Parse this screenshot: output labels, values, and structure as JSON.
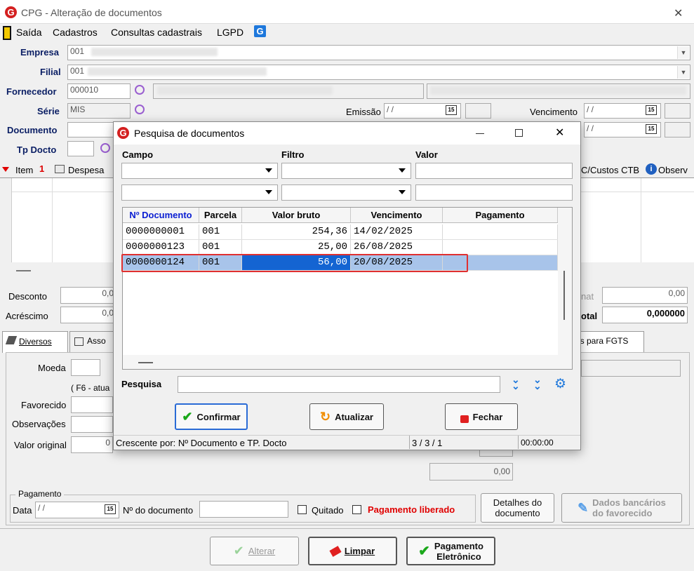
{
  "window": {
    "title": "CPG - Alteração de documentos",
    "close": "✕"
  },
  "menu": {
    "exit": "Saída",
    "cadastros": "Cadastros",
    "consultas": "Consultas cadastrais",
    "lgpd": "LGPD"
  },
  "form": {
    "empresa_label": "Empresa",
    "empresa_value": "001",
    "filial_label": "Filial",
    "filial_value": "001",
    "fornecedor_label": "Fornecedor",
    "fornecedor_value": "000010",
    "serie_label": "Série",
    "serie_value": "MIS",
    "emissao_label": "Emissão",
    "emissao_value": " / / ",
    "vencimento_label": "Vencimento",
    "vencimento_value": " / / ",
    "documento_label": "Documento",
    "tpdocto_label": "Tp Docto",
    "date2_value": " / / "
  },
  "grid": {
    "item_col": "Item",
    "despesa_col": "Despesa",
    "ccustos_col": "C/Custos CTB",
    "observ_col": "Observ"
  },
  "totals": {
    "desconto_label": "Desconto",
    "desconto_value": "0,0",
    "acrescimo_label": "Acréscimo",
    "acrescimo_value": "0,0",
    "nat_label": "nat",
    "nat_value": "0,00",
    "total_label": "otal",
    "total_value": "0,000000"
  },
  "tabs": {
    "diversos": "Diversos",
    "asso": "Asso",
    "fgts": "os para FGTS"
  },
  "lower": {
    "moeda_label": "Moeda",
    "f6_hint": "( F6 - atua",
    "favorecido_label": "Favorecido",
    "observacoes_label": "Observações",
    "valor_original_label": "Valor original",
    "valor_original_value": "0",
    "amount_value": "0,00"
  },
  "payment": {
    "group_label": "Pagamento",
    "data_label": "Data",
    "data_value": " / / ",
    "ndoc_label": "Nº do documento",
    "quitado_label": "Quitado",
    "liberado_label": "Pagamento liberado",
    "detalhes_line1": "Detalhes do",
    "detalhes_line2": "documento",
    "bancarios_line1": "Dados bancários",
    "bancarios_line2": "do favorecido"
  },
  "footer": {
    "alterar": "Alterar",
    "limpar": "Limpar",
    "pag_line1": "Pagamento",
    "pag_line2": "Eletrônico"
  },
  "dialog": {
    "title": "Pesquisa de documentos",
    "campo_label": "Campo",
    "filtro_label": "Filtro",
    "valor_label": "Valor",
    "headers": [
      "Nº Documento",
      "Parcela",
      "Valor bruto",
      "Vencimento",
      "Pagamento"
    ],
    "rows": [
      {
        "doc": "0000000001",
        "parcela": "001",
        "valor": "254,36",
        "venc": "14/02/2025",
        "pag": ""
      },
      {
        "doc": "0000000123",
        "parcela": "001",
        "valor": "25,00",
        "venc": "26/08/2025",
        "pag": ""
      },
      {
        "doc": "0000000124",
        "parcela": "001",
        "valor": "56,00",
        "venc": "20/08/2025",
        "pag": ""
      }
    ],
    "selected_row": 2,
    "pesquisa_label": "Pesquisa",
    "confirmar": "Confirmar",
    "atualizar": "Atualizar",
    "fechar": "Fechar",
    "status_sort": "Crescente por: Nº Documento e TP. Docto",
    "status_count": "3 / 3 / 1",
    "status_time": "00:00:00"
  },
  "colors": {
    "highlight_border": "#e03030",
    "selected_row": "#a8c4ea",
    "selected_cell": "#1464d2",
    "label_blue": "#0a1e64",
    "accent_blue": "#1e78dc",
    "red": "#e00000"
  }
}
